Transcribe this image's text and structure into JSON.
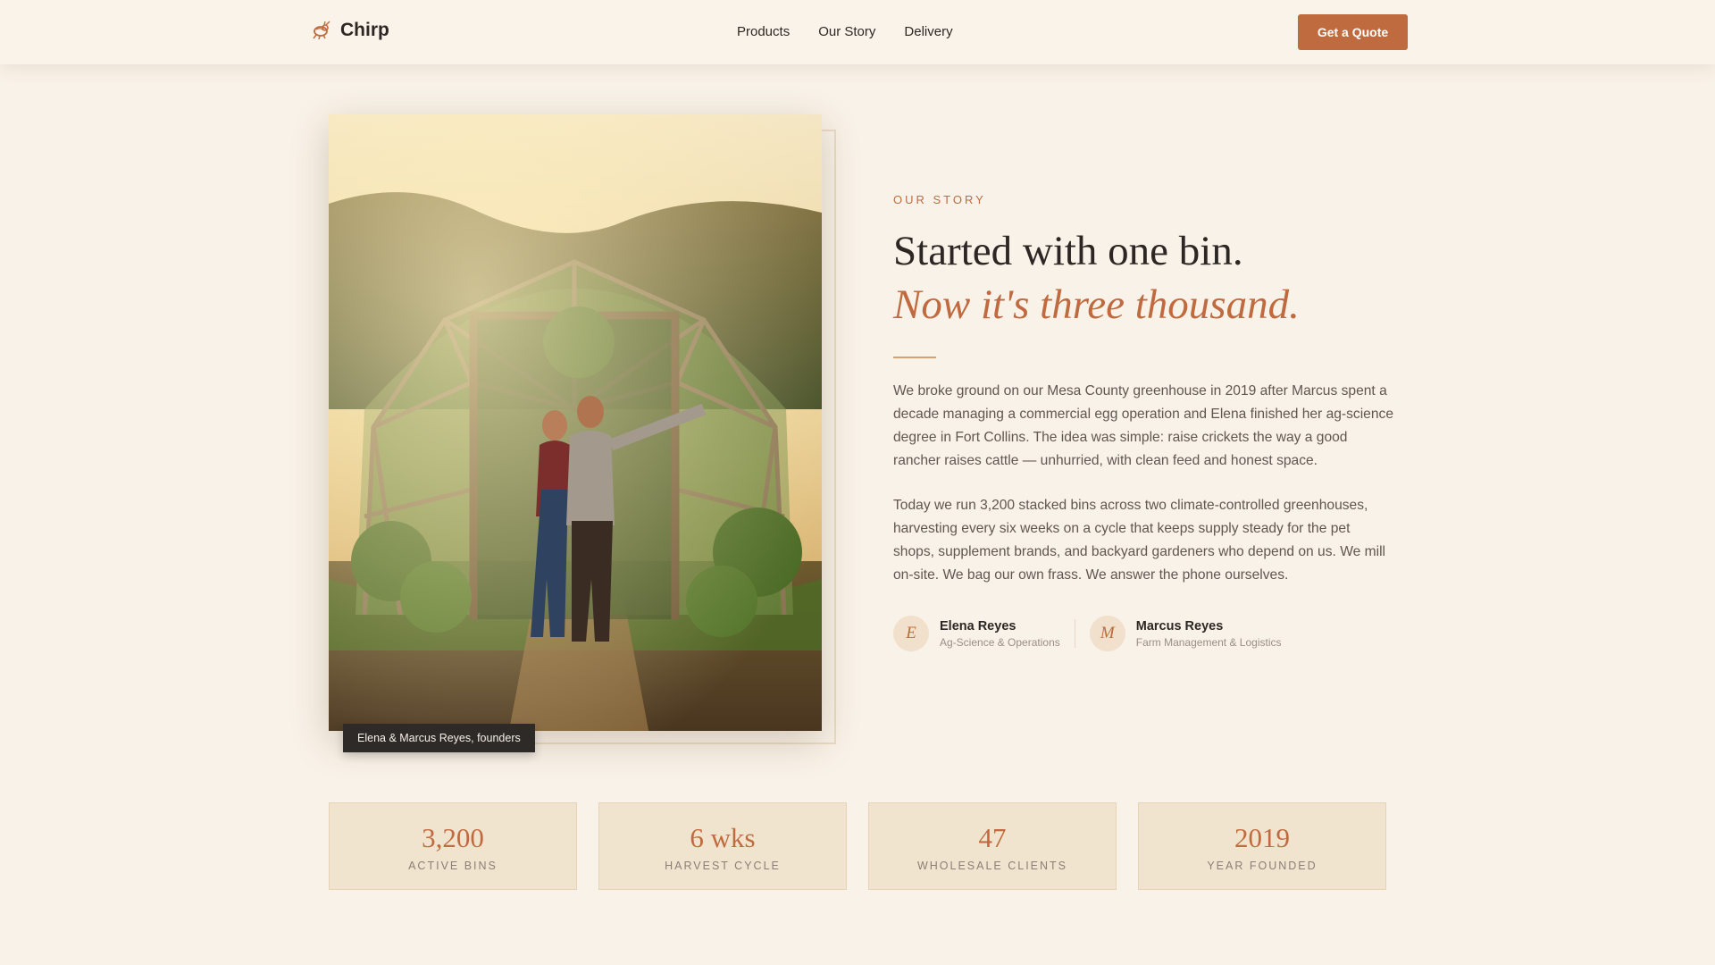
{
  "header": {
    "brand": "Chirp",
    "logo_icon": "cricket-icon",
    "nav": [
      "Products",
      "Our Story",
      "Delivery"
    ],
    "cta": "Get a Quote"
  },
  "story": {
    "eyebrow": "OUR STORY",
    "heading": "Started with one bin.",
    "heading_accent": "Now it's three thousand.",
    "paragraphs": [
      "We broke ground on our Mesa County greenhouse in 2019 after Marcus spent a decade managing a commercial egg operation and Elena finished her ag-science degree in Fort Collins. The idea was simple: raise crickets the way a good rancher raises cattle — unhurried, with clean feed and honest space.",
      "Today we run 3,200 stacked bins across two climate-controlled greenhouses, harvesting every six weeks on a cycle that keeps supply steady for the pet shops, supplement brands, and backyard gardeners who depend on us. We mill on-site. We bag our own frass. We answer the phone ourselves."
    ],
    "founders": [
      {
        "initial": "E",
        "name": "Elena Reyes",
        "role": "Ag-Science & Operations"
      },
      {
        "initial": "M",
        "name": "Marcus Reyes",
        "role": "Farm Management & Logistics"
      }
    ]
  },
  "photo": {
    "caption": "Elena & Marcus Reyes, founders"
  },
  "stats": [
    {
      "value": "3,200",
      "label": "ACTIVE BINS"
    },
    {
      "value": "6 wks",
      "label": "HARVEST CYCLE"
    },
    {
      "value": "47",
      "label": "WHOLESALE CLIENTS"
    },
    {
      "value": "2019",
      "label": "YEAR FOUNDED"
    }
  ],
  "colors": {
    "accent": "#bf6b3f",
    "background": "#f9f2e8",
    "stat_card": "#f1e4cf",
    "text": "#2c2724"
  }
}
